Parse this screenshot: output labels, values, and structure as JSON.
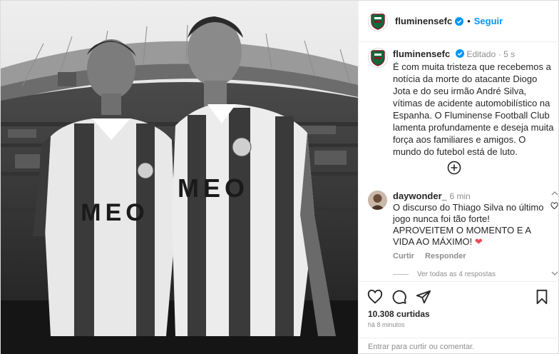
{
  "post": {
    "username": "fluminensefc",
    "follow_label": "Seguir",
    "edited_label": "Editado",
    "time_ago": "5 s",
    "caption": "É com muita tristeza que recebemos a notícia da morte do atacante Diogo Jota e do seu irmão André Silva, vítimas de acidente automobilístico na Espanha. O Fluminense Football Club lamenta profundamente e deseja muita força aos familiares e amigos. O mundo do futebol está de luto.",
    "likes": "10.308 curtidas",
    "posted": "há 8 minutos"
  },
  "photo": {
    "shirt_sponsor": "MEO"
  },
  "comment": {
    "username": "daywonder_",
    "time": "6 min",
    "text": "O discurso do Thiago Silva no último jogo nunca foi tão forte! APROVEITEM O MOMENTO E A VIDA AO MÁXIMO!",
    "emoji": "❤",
    "reply_label": "Curtir",
    "respond_label": "Responder",
    "view_replies": "Ver todas as 4 respostas"
  },
  "comment_box": {
    "placeholder": "Entrar para curtir ou comentar."
  },
  "icons": {
    "like": "heart-icon",
    "comment": "comment-icon",
    "share": "share-icon",
    "save": "bookmark-icon",
    "add": "plus-circle-icon",
    "verified": "verified-badge-icon"
  },
  "colors": {
    "accent": "#0095f6",
    "heart": "#ed4956",
    "club_green": "#0b6b3a",
    "club_maroon": "#8b1a2b"
  }
}
